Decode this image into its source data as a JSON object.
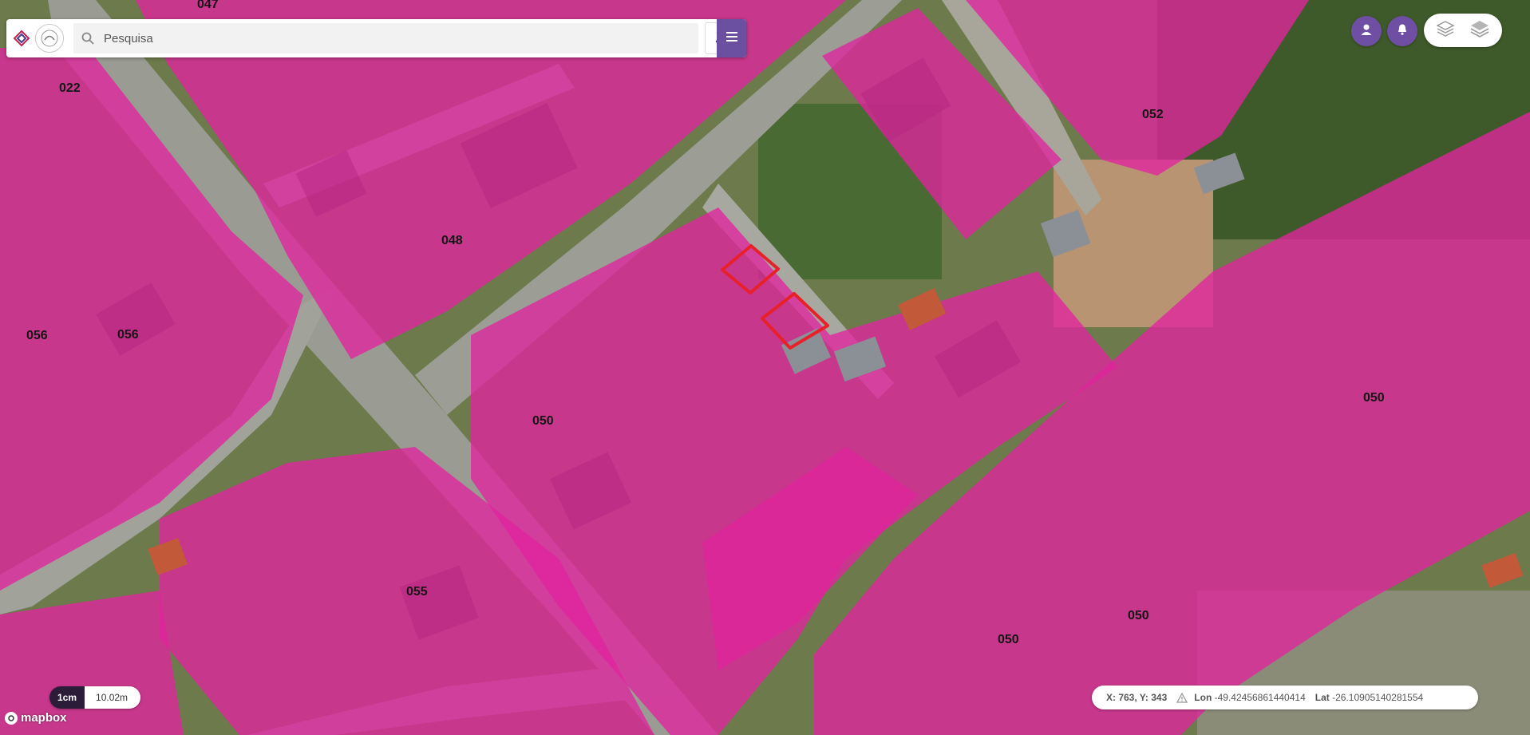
{
  "search": {
    "placeholder": "Pesquisa"
  },
  "map": {
    "parcel_labels": [
      "047",
      "022",
      "048",
      "056",
      "056",
      "050",
      "055",
      "052",
      "050",
      "050",
      "050"
    ],
    "overlay_color": "#e0249e",
    "highlight_color": "#e8202a"
  },
  "scale": {
    "unit_label": "1cm",
    "distance_label": "10.02m"
  },
  "attribution": {
    "logo_text": "mapbox"
  },
  "coords": {
    "xy_label": "X: 763, Y: 343",
    "lon_label": "Lon",
    "lon_value": "-49.42456861440414",
    "lat_label": "Lat",
    "lat_value": "-26.10905140281554"
  },
  "icons": {
    "logo": "app-logo-icon",
    "partner_logo": "partner-seal-icon",
    "search": "search-icon",
    "edit_tool": "map-tool-icon",
    "menu": "hamburger-menu-icon",
    "user": "user-icon",
    "bell": "bell-icon",
    "layers_a": "layers-icon",
    "layers_b": "layers-stack-icon",
    "warning": "warning-icon",
    "mapbox": "mapbox-logo-icon"
  },
  "colors": {
    "accent": "#6e4fa3",
    "overlay": "#e0249e"
  }
}
